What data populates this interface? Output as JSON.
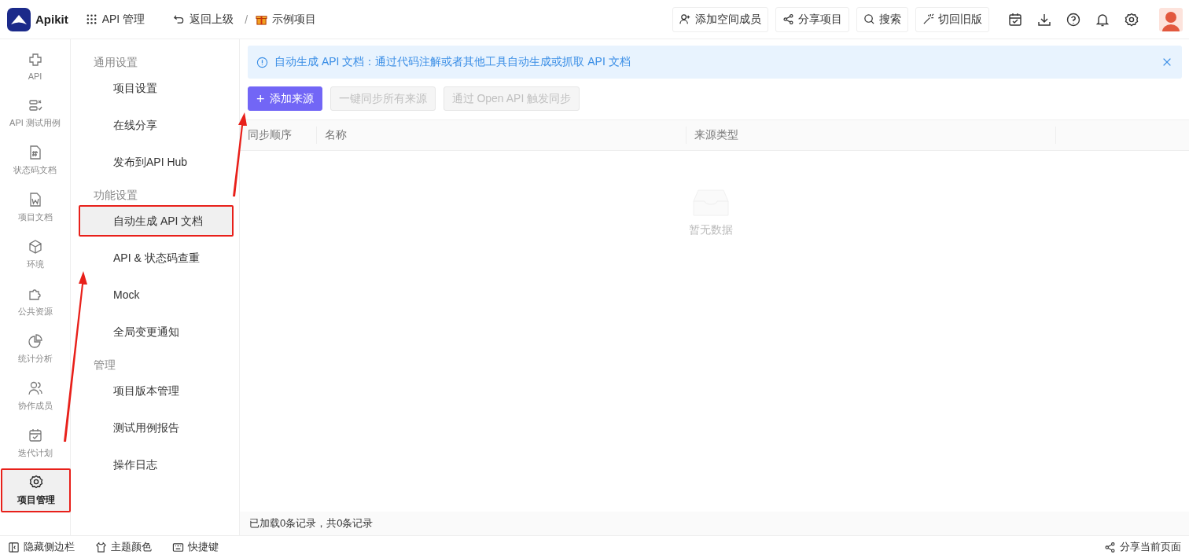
{
  "topbar": {
    "logo": "Apikit",
    "module": "API 管理",
    "back": "返回上级",
    "separator": "/",
    "project": "示例项目",
    "actions": [
      {
        "kind": "add-member",
        "label": "添加空间成员"
      },
      {
        "kind": "share",
        "label": "分享项目"
      },
      {
        "kind": "search",
        "label": "搜索"
      },
      {
        "kind": "wand",
        "label": "切回旧版"
      }
    ],
    "icons": [
      {
        "kind": "calendar"
      },
      {
        "kind": "download"
      },
      {
        "kind": "help"
      },
      {
        "kind": "bell"
      },
      {
        "kind": "settings"
      }
    ]
  },
  "rail": [
    {
      "kind": "api",
      "label": "API",
      "selected": false,
      "annotated": false
    },
    {
      "kind": "testcase",
      "label": "API 测试用例",
      "selected": false,
      "annotated": false
    },
    {
      "kind": "hash",
      "label": "状态码文档",
      "selected": false,
      "annotated": false
    },
    {
      "kind": "word",
      "label": "项目文档",
      "selected": false,
      "annotated": false
    },
    {
      "kind": "cube",
      "label": "环境",
      "selected": false,
      "annotated": false
    },
    {
      "kind": "puzzle",
      "label": "公共资源",
      "selected": false,
      "annotated": false
    },
    {
      "kind": "pie",
      "label": "统计分析",
      "selected": false,
      "annotated": false
    },
    {
      "kind": "users",
      "label": "协作成员",
      "selected": false,
      "annotated": false
    },
    {
      "kind": "calendar",
      "label": "迭代计划",
      "selected": false,
      "annotated": false
    },
    {
      "kind": "gear",
      "label": "项目管理",
      "selected": true,
      "annotated": true
    }
  ],
  "settings_menu": [
    {
      "title": "通用设置",
      "items": [
        {
          "label": "项目设置",
          "selected": false,
          "annotated": false
        },
        {
          "label": "在线分享",
          "selected": false,
          "annotated": false
        },
        {
          "label": "发布到API Hub",
          "selected": false,
          "annotated": false
        }
      ]
    },
    {
      "title": "功能设置",
      "items": [
        {
          "label": "自动生成 API 文档",
          "selected": true,
          "annotated": true
        },
        {
          "label": "API & 状态码查重",
          "selected": false,
          "annotated": false
        },
        {
          "label": "Mock",
          "selected": false,
          "annotated": false
        },
        {
          "label": "全局变更通知",
          "selected": false,
          "annotated": false
        }
      ]
    },
    {
      "title": "管理",
      "items": [
        {
          "label": "项目版本管理",
          "selected": false,
          "annotated": false
        },
        {
          "label": "测试用例报告",
          "selected": false,
          "annotated": false
        },
        {
          "label": "操作日志",
          "selected": false,
          "annotated": false
        }
      ]
    }
  ],
  "notice": {
    "text": "自动生成 API 文档：通过代码注解或者其他工具自动生成或抓取 API 文档"
  },
  "buttons": [
    {
      "label": "添加来源",
      "disabled": false,
      "icon": "+"
    },
    {
      "label": "一键同步所有来源",
      "disabled": true
    },
    {
      "label": "通过 Open API 触发同步",
      "disabled": true
    }
  ],
  "table": {
    "columns": [
      "同步顺序",
      "名称",
      "来源类型"
    ],
    "empty_text": "暂无数据"
  },
  "record_count": "已加载0条记录，共0条记录",
  "status_bar": {
    "left": [
      {
        "kind": "sidebar",
        "label": "隐藏侧边栏"
      },
      {
        "kind": "shirt",
        "label": "主题颜色"
      },
      {
        "kind": "keyboard",
        "label": "快捷键"
      }
    ],
    "right": {
      "label": "分享当前页面"
    }
  }
}
